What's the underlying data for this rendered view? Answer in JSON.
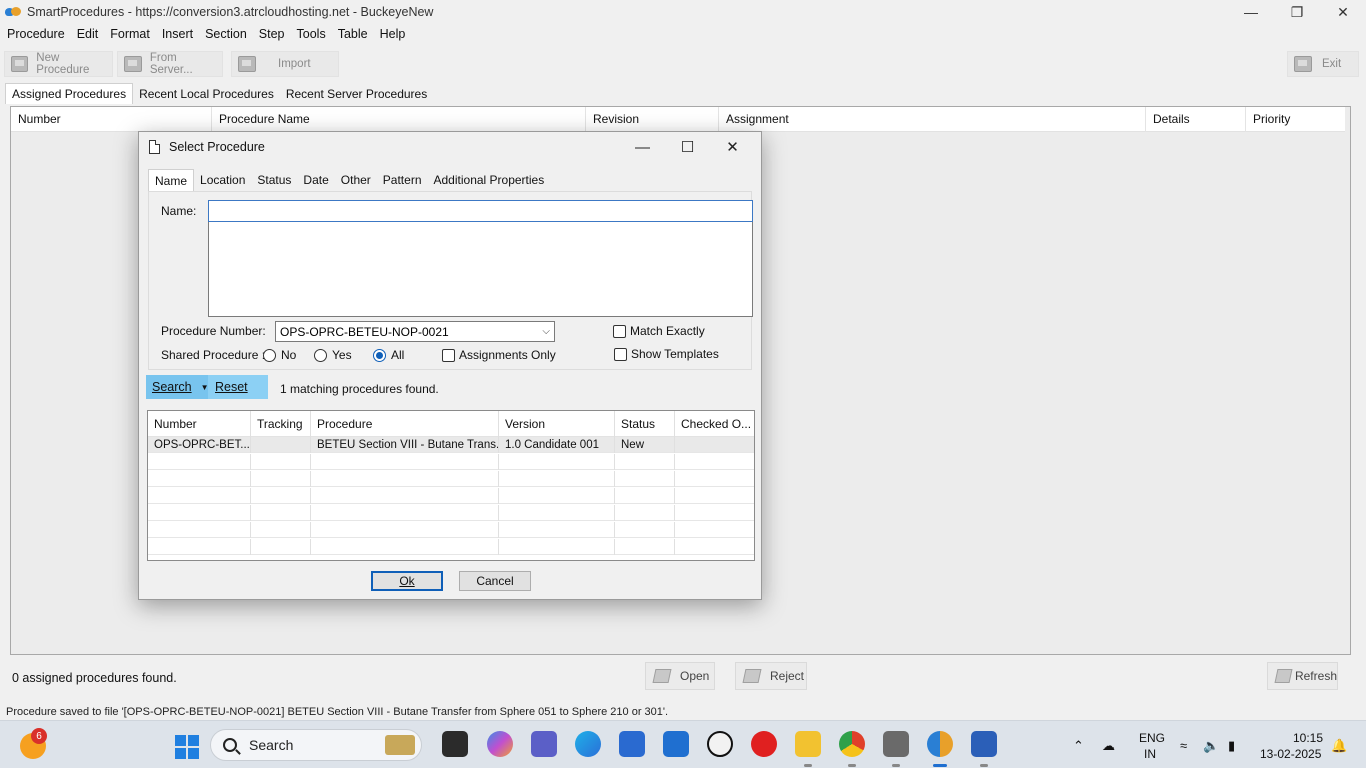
{
  "window": {
    "title": "SmartProcedures - https://conversion3.atrcloudhosting.net - BuckeyeNew",
    "minimize": "—",
    "maximize": "❐",
    "close": "✕"
  },
  "menu": [
    "Procedure",
    "Edit",
    "Format",
    "Insert",
    "Section",
    "Step",
    "Tools",
    "Table",
    "Help"
  ],
  "toolbar": {
    "new_procedure": "New Procedure",
    "from_server": "From Server...",
    "import": "Import",
    "exit": "Exit"
  },
  "main_tabs": [
    "Assigned Procedures",
    "Recent Local Procedures",
    "Recent Server Procedures"
  ],
  "main_grid": {
    "columns": [
      "Number",
      "Procedure Name",
      "Revision",
      "Assignment",
      "Details",
      "Priority"
    ]
  },
  "bottom": {
    "assigned_count": "0 assigned procedures found.",
    "open": "Open",
    "reject": "Reject",
    "refresh": "Refresh",
    "status": "Procedure saved to file '[OPS-OPRC-BETEU-NOP-0021] BETEU Section VIII - Butane Transfer from Sphere 051 to Sphere 210 or 301'."
  },
  "dialog": {
    "title": "Select Procedure",
    "minimize": "—",
    "maximize": "☐",
    "close": "✕",
    "tabs": [
      "Name",
      "Location",
      "Status",
      "Date",
      "Other",
      "Pattern",
      "Additional Properties"
    ],
    "name_label": "Name:",
    "name_value": "",
    "procedure_number_label": "Procedure Number:",
    "procedure_number_value": "OPS-OPRC-BETEU-NOP-0021",
    "match_exactly": "Match Exactly",
    "shared_label": "Shared Procedure :",
    "shared_options": [
      "No",
      "Yes",
      "All"
    ],
    "shared_selected": "All",
    "assignments_only": "Assignments Only",
    "show_templates": "Show Templates",
    "search": "Search",
    "reset": "Reset",
    "match_count": "1 matching procedures found.",
    "results": {
      "columns": [
        "Number",
        "Tracking",
        "Procedure",
        "Version",
        "Status",
        "Checked O..."
      ],
      "rows": [
        [
          "OPS-OPRC-BET...",
          "",
          "BETEU Section VIII - Butane Trans...",
          "1.0 Candidate 001",
          "New",
          ""
        ]
      ]
    },
    "ok": "Ok",
    "cancel": "Cancel"
  },
  "taskbar": {
    "weather_badge": "6",
    "search": "Search",
    "lang": "ENG",
    "region": "IN",
    "time": "10:15",
    "date": "13-02-2025"
  }
}
